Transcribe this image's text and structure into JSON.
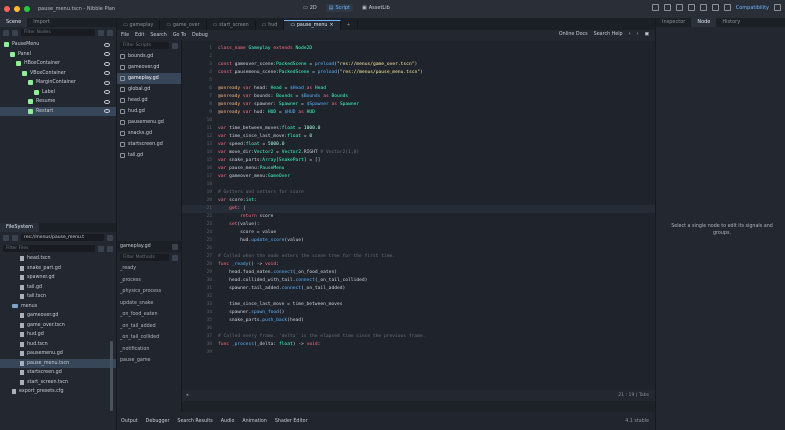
{
  "window": {
    "title": "pause_menu.tscn - Nibble Plan"
  },
  "main_menu": {
    "items": [
      "2D",
      "Script",
      "AssetLib"
    ],
    "active": "Script"
  },
  "renderer": "Compatibility",
  "scene_dock": {
    "tabs": [
      "Scene",
      "Import"
    ],
    "filter_placeholder": "Filter Nodes",
    "nodes": [
      {
        "label": "PauseMenu",
        "depth": 0,
        "color": "#8eef97"
      },
      {
        "label": "Panel",
        "depth": 1,
        "color": "#8eef97"
      },
      {
        "label": "HBoxContainer",
        "depth": 2,
        "color": "#8eef97"
      },
      {
        "label": "VBoxContainer",
        "depth": 3,
        "color": "#8eef97"
      },
      {
        "label": "MarginContainer",
        "depth": 4,
        "color": "#8eef97"
      },
      {
        "label": "Label",
        "depth": 5,
        "color": "#8eef97"
      },
      {
        "label": "Resume",
        "depth": 4,
        "color": "#8eef97"
      },
      {
        "label": "Restart",
        "depth": 4,
        "color": "#8eef97",
        "selected": true
      }
    ]
  },
  "fs_dock": {
    "tabs": [
      "FileSystem"
    ],
    "path": "res://menus/pause_menu.t",
    "filter_placeholder": "Filter Files",
    "items": [
      {
        "label": "head.tscn",
        "type": "file",
        "depth": 2
      },
      {
        "label": "snake_part.gd",
        "type": "file",
        "depth": 2
      },
      {
        "label": "spawner.gd",
        "type": "file",
        "depth": 2
      },
      {
        "label": "tail.gd",
        "type": "file",
        "depth": 2
      },
      {
        "label": "tail.tscn",
        "type": "file",
        "depth": 2
      },
      {
        "label": "menus",
        "type": "folder",
        "depth": 1
      },
      {
        "label": "gameover.gd",
        "type": "file",
        "depth": 2
      },
      {
        "label": "game_over.tscn",
        "type": "file",
        "depth": 2
      },
      {
        "label": "hud.gd",
        "type": "file",
        "depth": 2
      },
      {
        "label": "hud.tscn",
        "type": "file",
        "depth": 2
      },
      {
        "label": "pausemenu.gd",
        "type": "file",
        "depth": 2
      },
      {
        "label": "pause_menu.tscn",
        "type": "file",
        "depth": 2,
        "selected": true
      },
      {
        "label": "startscreen.gd",
        "type": "file",
        "depth": 2
      },
      {
        "label": "start_screen.tscn",
        "type": "file",
        "depth": 2
      },
      {
        "label": "export_presets.cfg",
        "type": "file",
        "depth": 1
      }
    ]
  },
  "editor_tabs": [
    "gameplay",
    "game_over",
    "start_screen",
    "hud",
    "pause_menu"
  ],
  "active_editor_tab": "pause_menu",
  "script_menu": {
    "items": [
      "File",
      "Edit",
      "Search",
      "Go To",
      "Debug"
    ],
    "online_docs": "Online Docs",
    "search_help": "Search Help"
  },
  "scripts_list": {
    "filter_placeholder": "Filter Scripts",
    "items": [
      "bounds.gd",
      "gameover.gd",
      "gameplay.gd",
      "global.gd",
      "head.gd",
      "hud.gd",
      "pausemenu.gd",
      "snacks.gd",
      "startscreen.gd",
      "tail.gd"
    ],
    "selected": "gameplay.gd"
  },
  "current_script": "gameplay.gd",
  "methods": {
    "filter_placeholder": "Filter Methods",
    "items": [
      "_ready",
      "_process",
      "_physics_process",
      "update_snake",
      "_on_food_eaten",
      "_on_tail_added",
      "_on_tail_collided",
      "_notification",
      "pause_game"
    ]
  },
  "code_lines": [
    {
      "n": 1,
      "t": [
        [
          "class_name ",
          "kw"
        ],
        [
          "Gameplay ",
          "ty"
        ],
        [
          "extends ",
          "kw"
        ],
        [
          "Node2D",
          "ty"
        ]
      ]
    },
    {
      "n": 2,
      "t": []
    },
    {
      "n": 3,
      "t": [
        [
          "const ",
          "kw"
        ],
        [
          "gameover_scene",
          "ct"
        ],
        [
          ":",
          "ct"
        ],
        [
          "PackedScene",
          "ty"
        ],
        [
          " = ",
          "ct"
        ],
        [
          "preload",
          "fn"
        ],
        [
          "(",
          "ct"
        ],
        [
          "\"res://menus/game_over.tscn\"",
          "st"
        ],
        [
          ")",
          "ct"
        ]
      ]
    },
    {
      "n": 4,
      "t": [
        [
          "const ",
          "kw"
        ],
        [
          "pausemenu_scene",
          "ct"
        ],
        [
          ":",
          "ct"
        ],
        [
          "PackedScene",
          "ty"
        ],
        [
          " = ",
          "ct"
        ],
        [
          "preload",
          "fn"
        ],
        [
          "(",
          "ct"
        ],
        [
          "\"res://menus/pause_menu.tscn\"",
          "st"
        ],
        [
          ")",
          "ct"
        ]
      ]
    },
    {
      "n": 5,
      "t": []
    },
    {
      "n": 6,
      "t": [
        [
          "@onready ",
          "an"
        ],
        [
          "var ",
          "kw"
        ],
        [
          "head",
          "ct"
        ],
        [
          ": ",
          "ct"
        ],
        [
          "Head",
          "ty"
        ],
        [
          " = ",
          "ct"
        ],
        [
          "$Head ",
          "fn"
        ],
        [
          "as ",
          "kw"
        ],
        [
          "Head",
          "ty"
        ]
      ]
    },
    {
      "n": 7,
      "t": [
        [
          "@onready ",
          "an"
        ],
        [
          "var ",
          "kw"
        ],
        [
          "bounds",
          "ct"
        ],
        [
          ": ",
          "ct"
        ],
        [
          "Bounds",
          "ty"
        ],
        [
          " = ",
          "ct"
        ],
        [
          "$Bounds ",
          "fn"
        ],
        [
          "as ",
          "kw"
        ],
        [
          "Bounds",
          "ty"
        ]
      ]
    },
    {
      "n": 8,
      "t": [
        [
          "@onready ",
          "an"
        ],
        [
          "var ",
          "kw"
        ],
        [
          "spawner",
          "ct"
        ],
        [
          ": ",
          "ct"
        ],
        [
          "Spawner",
          "ty"
        ],
        [
          " = ",
          "ct"
        ],
        [
          "$Spawner ",
          "fn"
        ],
        [
          "as ",
          "kw"
        ],
        [
          "Spawner",
          "ty"
        ]
      ]
    },
    {
      "n": 9,
      "t": [
        [
          "@onready ",
          "an"
        ],
        [
          "var ",
          "kw"
        ],
        [
          "hud",
          "ct"
        ],
        [
          ": ",
          "ct"
        ],
        [
          "HUD",
          "ty"
        ],
        [
          " = ",
          "ct"
        ],
        [
          "$HUD ",
          "fn"
        ],
        [
          "as ",
          "kw"
        ],
        [
          "HUD",
          "ty"
        ]
      ]
    },
    {
      "n": 10,
      "t": []
    },
    {
      "n": 11,
      "t": [
        [
          "var ",
          "kw"
        ],
        [
          "time_between_moves",
          "ct"
        ],
        [
          ":",
          "ct"
        ],
        [
          "float",
          "ty"
        ],
        [
          " = ",
          "ct"
        ],
        [
          "1000.0",
          "nu"
        ]
      ]
    },
    {
      "n": 12,
      "t": [
        [
          "var ",
          "kw"
        ],
        [
          "time_since_last_move",
          "ct"
        ],
        [
          ":",
          "ct"
        ],
        [
          "float",
          "ty"
        ],
        [
          " = ",
          "ct"
        ],
        [
          "0",
          "nu"
        ]
      ]
    },
    {
      "n": 13,
      "t": [
        [
          "var ",
          "kw"
        ],
        [
          "speed",
          "ct"
        ],
        [
          ":",
          "ct"
        ],
        [
          "float",
          "ty"
        ],
        [
          " = ",
          "ct"
        ],
        [
          "5000.0",
          "nu"
        ]
      ]
    },
    {
      "n": 14,
      "t": [
        [
          "var ",
          "kw"
        ],
        [
          "move_dir",
          "ct"
        ],
        [
          ":",
          "ct"
        ],
        [
          "Vector2",
          "ty"
        ],
        [
          " = ",
          "ct"
        ],
        [
          "Vector2",
          "ty"
        ],
        [
          ".RIGHT ",
          "ct"
        ],
        [
          "# Vector2(1,0)",
          "cm"
        ]
      ]
    },
    {
      "n": 15,
      "t": [
        [
          "var ",
          "kw"
        ],
        [
          "snake_parts",
          "ct"
        ],
        [
          ":",
          "ct"
        ],
        [
          "Array",
          "ty"
        ],
        [
          "[",
          "ct"
        ],
        [
          "SnakePart",
          "ty"
        ],
        [
          "] = []",
          "ct"
        ]
      ]
    },
    {
      "n": 16,
      "t": [
        [
          "var ",
          "kw"
        ],
        [
          "pause_menu",
          "ct"
        ],
        [
          ":",
          "ct"
        ],
        [
          "PauseMenu",
          "ty"
        ]
      ]
    },
    {
      "n": 17,
      "t": [
        [
          "var ",
          "kw"
        ],
        [
          "gameover_menu",
          "ct"
        ],
        [
          ":",
          "ct"
        ],
        [
          "GameOver",
          "ty"
        ]
      ]
    },
    {
      "n": 18,
      "t": []
    },
    {
      "n": 19,
      "t": [
        [
          "# Getters and setters for score",
          "cm"
        ]
      ]
    },
    {
      "n": 20,
      "t": [
        [
          "var ",
          "kw"
        ],
        [
          "score",
          "ct"
        ],
        [
          ":",
          "ct"
        ],
        [
          "int",
          "ty"
        ],
        [
          ":",
          "ct"
        ]
      ]
    },
    {
      "n": 21,
      "t": [
        [
          "    get",
          "kw"
        ],
        [
          ": ",
          "ct"
        ],
        [
          "|",
          "ct"
        ]
      ],
      "cur": true
    },
    {
      "n": 22,
      "t": [
        [
          "        return ",
          "kw"
        ],
        [
          "score",
          "ct"
        ]
      ]
    },
    {
      "n": 23,
      "t": [
        [
          "    set",
          "kw"
        ],
        [
          "(",
          "ct"
        ],
        [
          "value",
          "ct"
        ],
        [
          "):",
          "ct"
        ]
      ]
    },
    {
      "n": 24,
      "t": [
        [
          "        score = value",
          "ct"
        ]
      ]
    },
    {
      "n": 25,
      "t": [
        [
          "        hud",
          "ct"
        ],
        [
          ".",
          "ct"
        ],
        [
          "update_score",
          "fn"
        ],
        [
          "(value)",
          "ct"
        ]
      ]
    },
    {
      "n": 26,
      "t": []
    },
    {
      "n": 27,
      "t": [
        [
          "# Called when the node enters the scene tree for the first time.",
          "cm"
        ]
      ]
    },
    {
      "n": 28,
      "t": [
        [
          "func ",
          "kw"
        ],
        [
          "_ready",
          "fn"
        ],
        [
          "() -> ",
          "ct"
        ],
        [
          "void",
          "kw"
        ],
        [
          ":",
          "ct"
        ]
      ]
    },
    {
      "n": 29,
      "t": [
        [
          "    head",
          "ct"
        ],
        [
          ".food_eaten.",
          "ct"
        ],
        [
          "connect",
          "fn"
        ],
        [
          "(_on_food_eaten)",
          "ct"
        ]
      ]
    },
    {
      "n": 30,
      "t": [
        [
          "    head",
          "ct"
        ],
        [
          ".collided_with_tail.",
          "ct"
        ],
        [
          "connect",
          "fn"
        ],
        [
          "(_on_tail_collided)",
          "ct"
        ]
      ]
    },
    {
      "n": 31,
      "t": [
        [
          "    spawner",
          "ct"
        ],
        [
          ".tail_added.",
          "ct"
        ],
        [
          "connect",
          "fn"
        ],
        [
          "(_on_tail_added)",
          "ct"
        ]
      ]
    },
    {
      "n": 32,
      "t": []
    },
    {
      "n": 33,
      "t": [
        [
          "    time_since_last_move = time_between_moves",
          "ct"
        ]
      ]
    },
    {
      "n": 34,
      "t": [
        [
          "    spawner",
          "ct"
        ],
        [
          ".",
          "ct"
        ],
        [
          "spawn_food",
          "fn"
        ],
        [
          "()",
          "ct"
        ]
      ]
    },
    {
      "n": 35,
      "t": [
        [
          "    snake_parts",
          "ct"
        ],
        [
          ".",
          "ct"
        ],
        [
          "push_back",
          "fn"
        ],
        [
          "(head)",
          "ct"
        ]
      ]
    },
    {
      "n": 36,
      "t": []
    },
    {
      "n": 37,
      "t": [
        [
          "# Called every frame. 'delta' is the elapsed time since the previous frame.",
          "cm"
        ]
      ]
    },
    {
      "n": 38,
      "t": [
        [
          "func ",
          "kw"
        ],
        [
          "_process",
          "fn"
        ],
        [
          "(_delta: ",
          "ct"
        ],
        [
          "float",
          "ty"
        ],
        [
          ") -> ",
          "ct"
        ],
        [
          "void",
          "kw"
        ],
        [
          ":",
          "ct"
        ]
      ]
    },
    {
      "n": 39,
      "t": []
    }
  ],
  "status": {
    "position": "21 :  19 | Tabs"
  },
  "bottom_tabs": [
    "Output",
    "Debugger",
    "Search Results",
    "Audio",
    "Animation",
    "Shader Editor"
  ],
  "version": "4.1 stable",
  "inspector": {
    "tabs": [
      "Inspector",
      "Node",
      "History"
    ],
    "active": "Node",
    "message": "Select a single node to edit its signals and groups."
  }
}
